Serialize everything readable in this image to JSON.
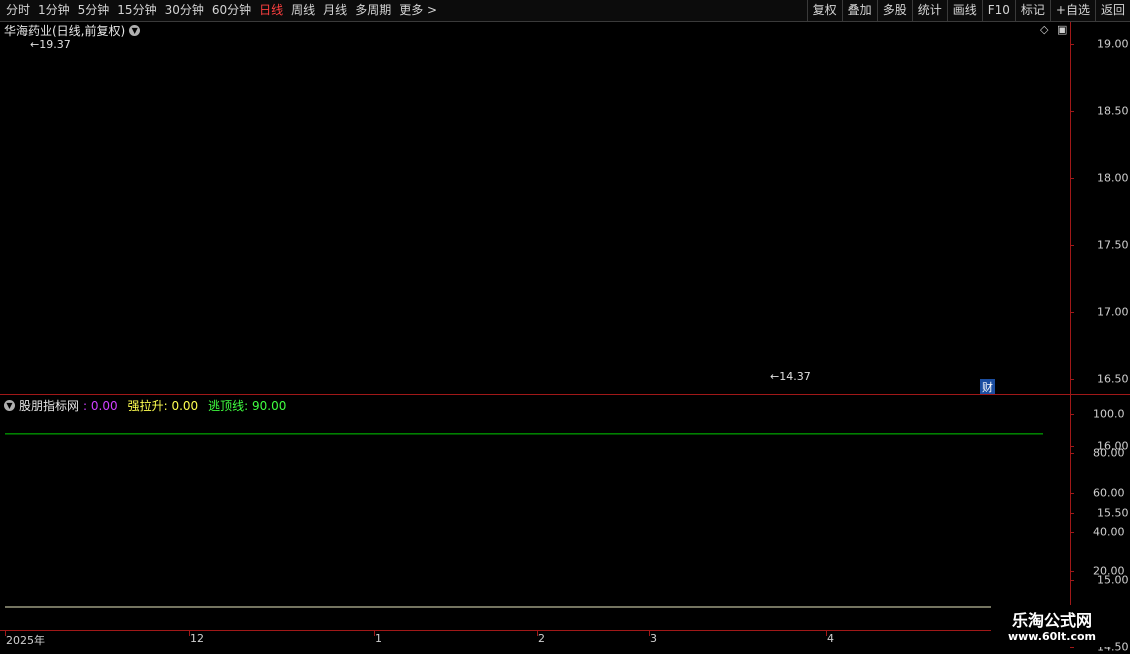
{
  "toolbar": {
    "periods": [
      {
        "label": "分时",
        "active": false
      },
      {
        "label": "1分钟",
        "active": false
      },
      {
        "label": "5分钟",
        "active": false
      },
      {
        "label": "15分钟",
        "active": false
      },
      {
        "label": "30分钟",
        "active": false
      },
      {
        "label": "60分钟",
        "active": false
      },
      {
        "label": "日线",
        "active": true
      },
      {
        "label": "周线",
        "active": false
      },
      {
        "label": "月线",
        "active": false
      },
      {
        "label": "多周期",
        "active": false
      },
      {
        "label": "更多 >",
        "active": false
      }
    ],
    "right_buttons": [
      "复权",
      "叠加",
      "多股",
      "统计",
      "画线",
      "F10",
      "标记",
      "+自选",
      "返回"
    ]
  },
  "main_panel": {
    "title": "华海药业(日线,前复权)",
    "high_label": "19.37",
    "low_label": "14.37",
    "badge": "财",
    "price_ticks": [
      "19.00",
      "18.50",
      "18.00",
      "17.50",
      "17.00",
      "16.50",
      "16.00",
      "15.50",
      "15.00",
      "14.50"
    ]
  },
  "indicator_panel": {
    "name": "股朋指标网",
    "value": ": 0.00",
    "qls_label": "强拉升: 0.00",
    "tdx_label": "逃顶线: 90.00",
    "ticks": [
      "100.0",
      "80.00",
      "60.00",
      "40.00",
      "20.00"
    ]
  },
  "x_axis": {
    "labels": [
      "2025年",
      "12",
      "1",
      "2",
      "3",
      "4"
    ]
  },
  "watermark": {
    "title": "乐淘公式网",
    "url": "www.60lt.com"
  },
  "colors": {
    "up": "#ff3232",
    "down": "#54ffff",
    "ind_up": "#ff1a1a",
    "ind_down": "#22dd22",
    "signal_bar": "#ffff00",
    "top_line": "#00cc00"
  },
  "chart_data": [
    {
      "type": "candlestick",
      "title": "华海药业(日线,前复权)",
      "ylim": [
        14.3,
        19.6
      ],
      "y_ticks": [
        19.0,
        18.5,
        18.0,
        17.5,
        17.0,
        16.5,
        16.0,
        15.5,
        15.0,
        14.5
      ],
      "x_ticks": [
        "2025年",
        "12",
        "1",
        "2",
        "3",
        "4"
      ],
      "annotations": [
        {
          "text": "19.37"
        },
        {
          "text": "14.37"
        },
        {
          "text": "财"
        }
      ]
    },
    {
      "type": "bar",
      "title": "股朋指标网",
      "ylim": [
        0,
        100
      ],
      "y_ticks": [
        100,
        80,
        60,
        40,
        20
      ],
      "reference_lines": [
        {
          "name": "逃顶线",
          "value": 90
        }
      ],
      "values_shown": {
        "股朋指标网": 0.0,
        "强拉升": 0.0,
        "逃顶线": 90.0
      }
    }
  ]
}
